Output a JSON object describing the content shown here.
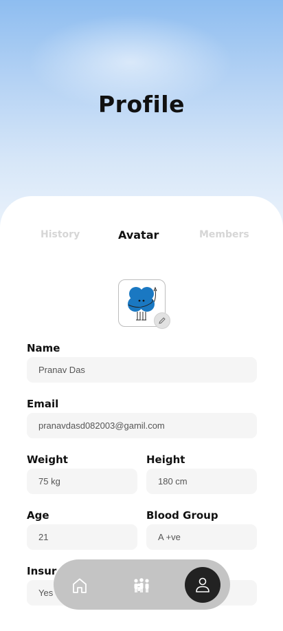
{
  "header": {
    "title": "Profile"
  },
  "tabs": [
    {
      "label": "History",
      "active": false
    },
    {
      "label": "Avatar",
      "active": true
    },
    {
      "label": "Members",
      "active": false
    }
  ],
  "avatar": {
    "icon": "blue-flower-character",
    "edit_icon": "pencil-icon"
  },
  "form": {
    "name": {
      "label": "Name",
      "value": "Pranav Das"
    },
    "email": {
      "label": "Email",
      "value": "pranavdasd082003@gamil.com"
    },
    "weight": {
      "label": "Weight",
      "value": "75 kg"
    },
    "height": {
      "label": "Height",
      "value": "180 cm"
    },
    "age": {
      "label": "Age",
      "value": "21"
    },
    "blood_group": {
      "label": "Blood Group",
      "value": "A +ve"
    },
    "insurance": {
      "label": "Insur",
      "value": "Yes"
    }
  },
  "bottom_nav": [
    {
      "icon": "home-icon",
      "active": false
    },
    {
      "icon": "family-icon",
      "active": false
    },
    {
      "icon": "user-icon",
      "active": true
    }
  ],
  "colors": {
    "accent_blue": "#1a78c2",
    "nav_background": "#c4c4c4",
    "nav_active": "#222222",
    "field_background": "#f5f5f5"
  }
}
